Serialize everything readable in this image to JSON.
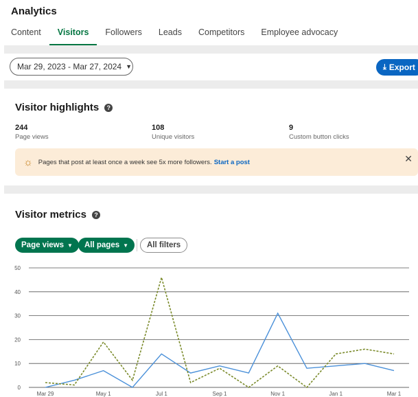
{
  "header": {
    "title": "Analytics"
  },
  "tabs": [
    {
      "label": "Content"
    },
    {
      "label": "Visitors"
    },
    {
      "label": "Followers"
    },
    {
      "label": "Leads"
    },
    {
      "label": "Competitors"
    },
    {
      "label": "Employee advocacy"
    }
  ],
  "active_tab": "Visitors",
  "toolbar": {
    "date_range": "Mar 29, 2023 - Mar 27, 2024",
    "export_label": "Export"
  },
  "highlights": {
    "title": "Visitor highlights",
    "stats": [
      {
        "value": "244",
        "label": "Page views"
      },
      {
        "value": "108",
        "label": "Unique visitors"
      },
      {
        "value": "9",
        "label": "Custom button clicks"
      }
    ],
    "banner": {
      "text": "Pages that post at least once a week see 5x more followers.",
      "link": "Start a post"
    }
  },
  "metrics": {
    "title": "Visitor metrics",
    "filters": {
      "metric": "Page views",
      "pages": "All pages",
      "all_filters": "All filters"
    }
  },
  "colors": {
    "accent": "#057642",
    "link": "#0a66c2",
    "series_solid": "#4a90d9",
    "series_dashed": "#7a8a2a"
  },
  "chart_data": {
    "type": "line",
    "x_ticks": [
      "Mar 29",
      "May 1",
      "Jul 1",
      "Sep 1",
      "Nov 1",
      "Jan 1",
      "Mar 1"
    ],
    "y_ticks": [
      0,
      10,
      20,
      30,
      40,
      50
    ],
    "ylim": [
      0,
      50
    ],
    "grid": true,
    "series": [
      {
        "style": "solid",
        "color": "#4a90d9",
        "values": [
          0,
          3,
          7,
          0,
          14,
          6,
          9,
          6,
          31,
          8,
          9,
          10,
          7
        ]
      },
      {
        "style": "dashed",
        "color": "#7a8a2a",
        "values": [
          2,
          1,
          19,
          3,
          46,
          2,
          8,
          0,
          9,
          0,
          14,
          16,
          14
        ]
      }
    ]
  }
}
